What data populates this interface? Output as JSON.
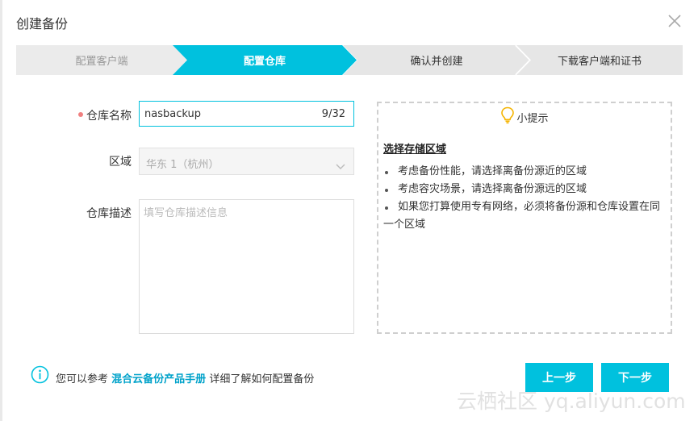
{
  "dialog": {
    "title": "创建备份"
  },
  "steps": [
    {
      "label": "配置客户端",
      "state": "done"
    },
    {
      "label": "配置仓库",
      "state": "active"
    },
    {
      "label": "确认并创建",
      "state": "pending"
    },
    {
      "label": "下载客户端和证书",
      "state": "pending"
    }
  ],
  "colors": {
    "accent": "#00c1de",
    "step_inactive": "#e6e6e6",
    "link": "#00a2ca",
    "required_dot": "#f08080"
  },
  "form": {
    "name_label": "仓库名称",
    "name_value": "nasbackup",
    "name_counter": "9/32",
    "region_label": "区域",
    "region_value": "华东 1（杭州）",
    "desc_label": "仓库描述",
    "desc_placeholder": "填写仓库描述信息"
  },
  "tips": {
    "header": "小提示",
    "title": "选择存储区域",
    "items": [
      "考虑备份性能，请选择离备份源近的区域",
      "考虑容灾场景，请选择离备份源远的区域",
      "如果您打算使用专有网络，必须将备份源和仓库设置在同一个区域"
    ]
  },
  "footer": {
    "text_before": "您可以参考",
    "link_text": "混合云备份产品手册",
    "text_after": "详细了解如何配置备份"
  },
  "buttons": {
    "prev": "上一步",
    "next": "下一步"
  },
  "watermark": "云栖社区 yq.aliyun.com",
  "icons": {
    "close": "close-icon",
    "lightbulb": "lightbulb-icon",
    "info": "info-icon",
    "chevron": "chevron-down-icon"
  }
}
